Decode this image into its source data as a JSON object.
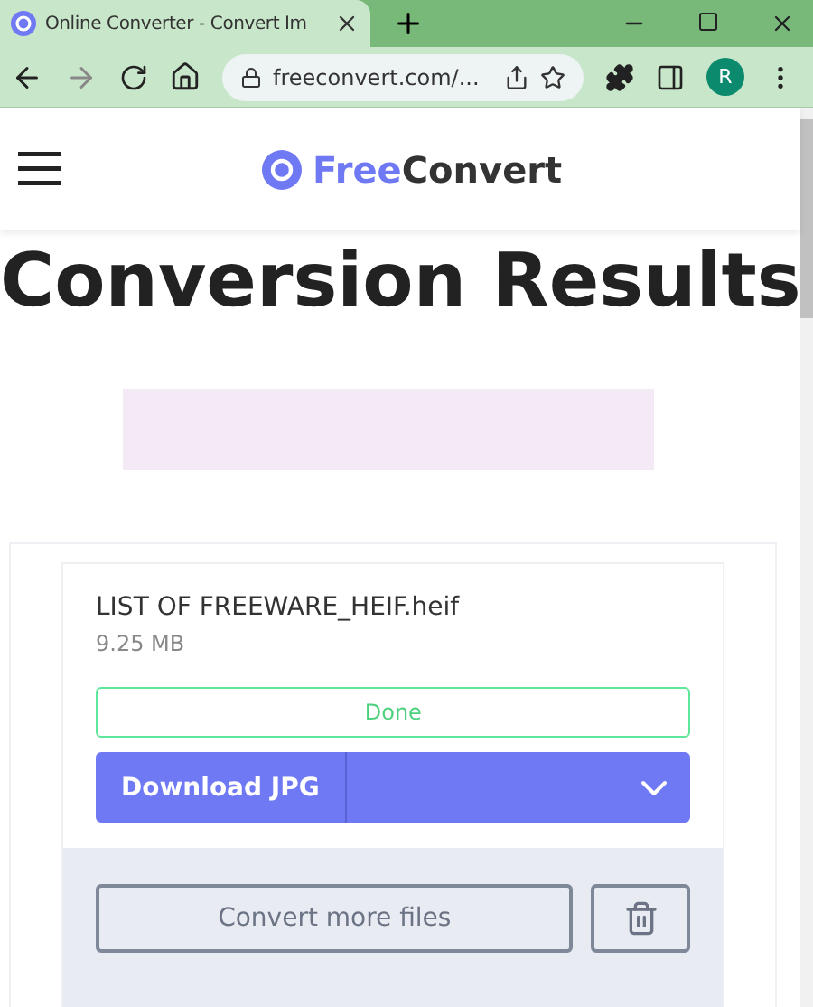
{
  "browser": {
    "tab_title": "Online Converter - Convert Im",
    "url": "freeconvert.com/...",
    "profile_initial": "R"
  },
  "header": {
    "logo_first": "Free",
    "logo_second": "Convert"
  },
  "title": "Conversion Results",
  "file": {
    "name": "LIST OF FREEWARE_HEIF.heif",
    "size": "9.25 MB",
    "status": "Done",
    "download_label": "Download JPG"
  },
  "footer": {
    "convert_more": "Convert more files"
  }
}
